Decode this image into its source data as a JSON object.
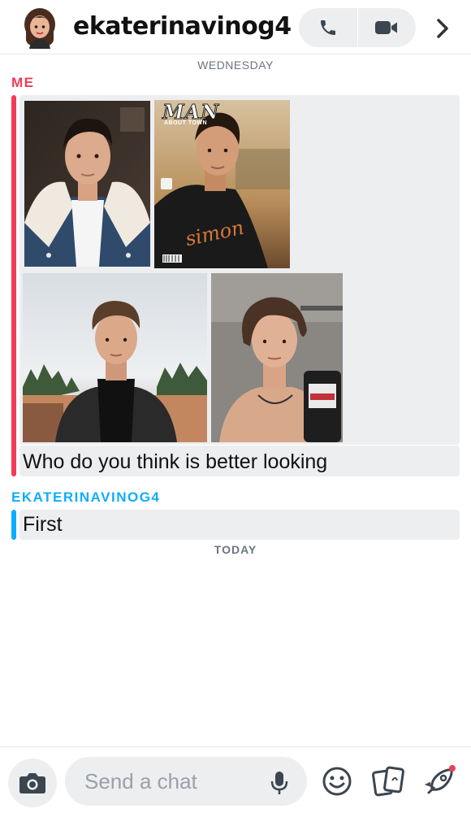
{
  "header": {
    "username": "ekaterinavinog4",
    "avatar_icon": "bitmoji-avatar",
    "call_icon": "phone-icon",
    "video_icon": "video-camera-icon",
    "more_icon": "chevron-right-icon"
  },
  "days": {
    "wednesday": "WEDNESDAY",
    "today": "TODAY"
  },
  "messages": [
    {
      "sender": "ME",
      "color": "#f23c57",
      "photos": [
        "photo-1",
        "photo-2",
        "photo-3",
        "photo-4"
      ],
      "magazine_title": "MAN",
      "magazine_subtitle": "ABOUT TOWN",
      "magazine_script": "simon",
      "text": "Who do you think is better looking"
    },
    {
      "sender": "EKATERINAVINOG4",
      "color": "#0fadff",
      "text": "First"
    }
  ],
  "composer": {
    "placeholder": "Send a chat",
    "camera_icon": "camera-icon",
    "mic_icon": "microphone-icon",
    "emoji_icon": "smiley-icon",
    "cards_icon": "cards-icon",
    "rocket_icon": "rocket-icon"
  }
}
